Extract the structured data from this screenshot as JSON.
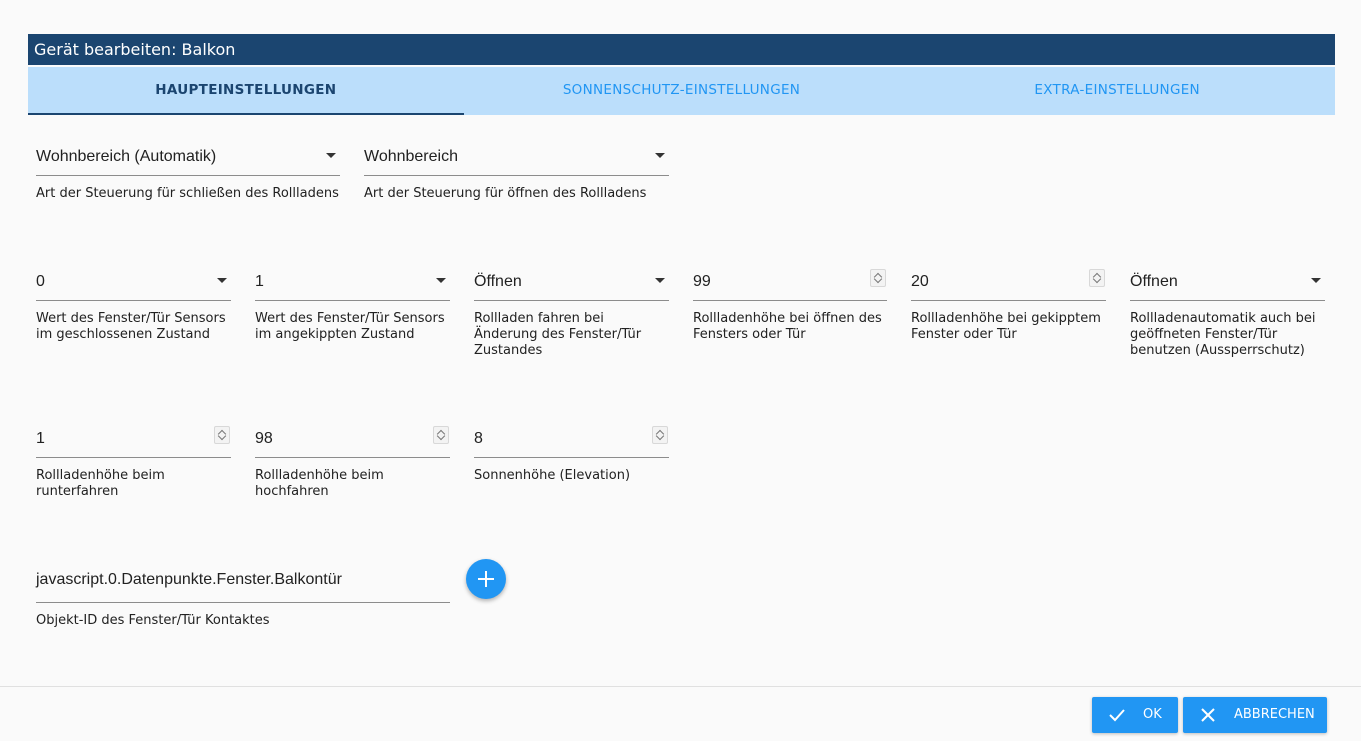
{
  "dialog": {
    "title": "Gerät bearbeiten: Balkon"
  },
  "tabs": [
    {
      "label": "HAUPTEINSTELLUNGEN",
      "active": true
    },
    {
      "label": "SONNENSCHUTZ-EINSTELLUNGEN",
      "active": false
    },
    {
      "label": "EXTRA-EINSTELLUNGEN",
      "active": false
    }
  ],
  "row1": {
    "close_type": {
      "value": "Wohnbereich (Automatik)",
      "help": "Art der Steuerung für schließen des Rollladens"
    },
    "open_type": {
      "value": "Wohnbereich",
      "help": "Art der Steuerung für öffnen des Rollladens"
    }
  },
  "row2": {
    "sensor_closed": {
      "value": "0",
      "help": "Wert des Fenster/Tür Sensors im geschlossenen Zustand"
    },
    "sensor_tilted": {
      "value": "1",
      "help": "Wert des Fenster/Tür Sensors im angekippten Zustand"
    },
    "on_change": {
      "value": "Öffnen",
      "help": "Rollladen fahren bei Änderung des Fenster/Tür Zustandes"
    },
    "height_open": {
      "value": "99",
      "help": "Rollladenhöhe bei öffnen des Fensters oder Tür"
    },
    "height_tilted": {
      "value": "20",
      "help": "Rollladenhöhe bei gekipptem Fenster oder Tür"
    },
    "lockout": {
      "value": "Öffnen",
      "help": "Rollladenautomatik auch bei geöffneten Fenster/Tür benutzen (Aussperrschutz)"
    }
  },
  "row3": {
    "height_down": {
      "value": "1",
      "help": "Rollladenhöhe beim runterfahren"
    },
    "height_up": {
      "value": "98",
      "help": "Rollladenhöhe beim hochfahren"
    },
    "elevation": {
      "value": "8",
      "help": "Sonnenhöhe (Elevation)"
    }
  },
  "row4": {
    "object_id": {
      "value": "javascript.0.Datenpunkte.Fenster.Balkontür",
      "help": "Objekt-ID des Fenster/Tür Kontaktes"
    }
  },
  "footer": {
    "ok_label": "OK",
    "cancel_label": "ABBRECHEN"
  },
  "colors": {
    "titlebar": "#1b4570",
    "tabbar": "#bbdefb",
    "accent": "#2196f3"
  }
}
